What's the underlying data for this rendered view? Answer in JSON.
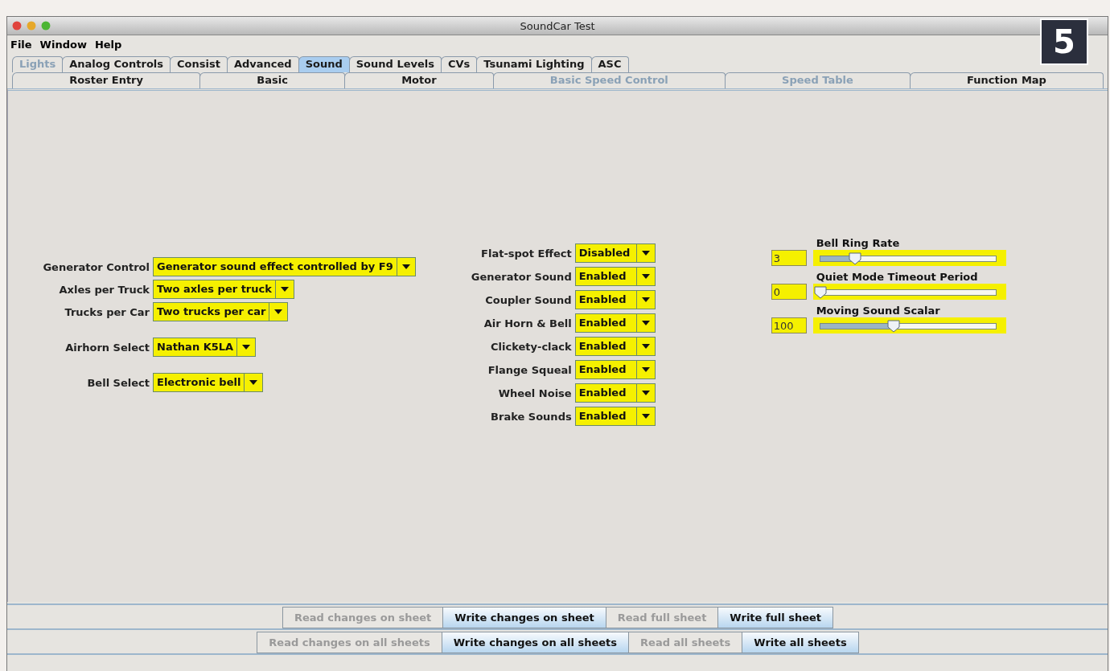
{
  "window": {
    "title": "SoundCar Test"
  },
  "step_badge": "5",
  "menu": [
    "File",
    "Window",
    "Help"
  ],
  "tabs_row_1": [
    {
      "label": "Lights",
      "selected": false,
      "disabled": true
    },
    {
      "label": "Analog Controls",
      "selected": false,
      "disabled": false
    },
    {
      "label": "Consist",
      "selected": false,
      "disabled": false
    },
    {
      "label": "Advanced",
      "selected": false,
      "disabled": false
    },
    {
      "label": "Sound",
      "selected": true,
      "disabled": false
    },
    {
      "label": "Sound Levels",
      "selected": false,
      "disabled": false
    },
    {
      "label": "CVs",
      "selected": false,
      "disabled": false
    },
    {
      "label": "Tsunami Lighting",
      "selected": false,
      "disabled": false
    },
    {
      "label": "ASC",
      "selected": false,
      "disabled": false
    }
  ],
  "tabs_row_2": [
    {
      "label": "Roster Entry",
      "selected": false,
      "disabled": false
    },
    {
      "label": "Basic",
      "selected": false,
      "disabled": false
    },
    {
      "label": "Motor",
      "selected": false,
      "disabled": false
    },
    {
      "label": "Basic Speed Control",
      "selected": false,
      "disabled": true
    },
    {
      "label": "Speed Table",
      "selected": false,
      "disabled": true
    },
    {
      "label": "Function Map",
      "selected": false,
      "disabled": false
    }
  ],
  "left_groups": [
    [
      {
        "label": "Generator Control",
        "value": "Generator sound effect controlled by F9"
      },
      {
        "label": "Axles per Truck",
        "value": "Two axles per truck"
      },
      {
        "label": "Trucks per Car",
        "value": "Two trucks per car"
      }
    ],
    [
      {
        "label": "Airhorn Select",
        "value": "Nathan K5LA"
      }
    ],
    [
      {
        "label": "Bell Select",
        "value": "Electronic bell"
      }
    ]
  ],
  "middle_settings": [
    {
      "label": "Flat-spot Effect",
      "value": "Disabled"
    },
    {
      "label": "Generator Sound",
      "value": "Enabled"
    },
    {
      "label": "Coupler Sound",
      "value": "Enabled"
    },
    {
      "label": "Air Horn & Bell",
      "value": "Enabled"
    },
    {
      "label": "Clickety-clack",
      "value": "Enabled"
    },
    {
      "label": "Flange Squeal",
      "value": "Enabled"
    },
    {
      "label": "Wheel Noise",
      "value": "Enabled"
    },
    {
      "label": "Brake Sounds",
      "value": "Enabled"
    }
  ],
  "sliders": [
    {
      "label": "Bell Ring Rate",
      "value": "3",
      "level": 0.2
    },
    {
      "label": "Quiet Mode Timeout Period",
      "value": "0",
      "level": 0.0
    },
    {
      "label": "Moving Sound Scalar",
      "value": "100",
      "level": 0.42
    }
  ],
  "sheet_buttons": [
    {
      "label": "Read changes on sheet",
      "disabled": true
    },
    {
      "label": "Write changes on sheet",
      "disabled": false
    },
    {
      "label": "Read full sheet",
      "disabled": true
    },
    {
      "label": "Write full sheet",
      "disabled": false
    }
  ],
  "all_sheets_buttons": [
    {
      "label": "Read changes on all sheets",
      "disabled": true
    },
    {
      "label": "Write changes on all sheets",
      "disabled": false
    },
    {
      "label": "Read all sheets",
      "disabled": true
    },
    {
      "label": "Write all sheets",
      "disabled": false
    }
  ]
}
